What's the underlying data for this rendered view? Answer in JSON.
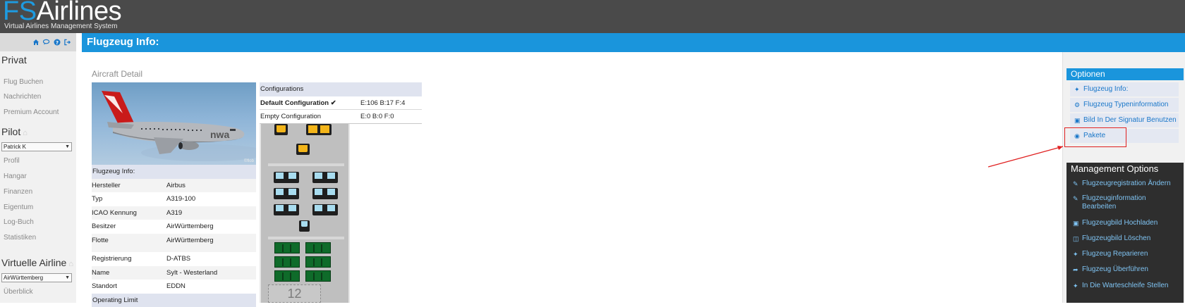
{
  "header": {
    "logo_fs": "FS",
    "logo_airlines": "Airlines",
    "logo_subtitle": "Virtual Airlines Management System"
  },
  "quickbar": {
    "icons": [
      "home-icon",
      "chat-icon",
      "help-icon",
      "logout-icon"
    ]
  },
  "sidebar": {
    "privat_heading": "Privat",
    "privat_items": [
      "Flug Buchen",
      "Nachrichten",
      "Premium Account"
    ],
    "pilot_heading": "Pilot",
    "pilot_select": "Patrick K",
    "pilot_items": [
      "Profil",
      "Hangar",
      "Finanzen",
      "Eigentum",
      "Log-Buch",
      "Statistiken"
    ],
    "va_heading": "Virtuelle Airline",
    "va_select": "AirWürttemberg",
    "va_items": [
      "Überblick"
    ]
  },
  "page": {
    "title": "Flugzeug Info:",
    "section_title": "Aircraft Detail",
    "photo_credit": "©flob",
    "livery_text": "nwa"
  },
  "info": {
    "heading": "Flugzeug Info:",
    "rows": [
      {
        "label": "Hersteller",
        "value": "Airbus"
      },
      {
        "label": "Typ",
        "value": "A319-100"
      },
      {
        "label": "ICAO Kennung",
        "value": "A319"
      },
      {
        "label": "Besitzer",
        "value": "AirWürttemberg"
      },
      {
        "label": "Flotte",
        "value": "AirWürttemberg"
      }
    ],
    "rows2": [
      {
        "label": "Registrierung",
        "value": "D-ATBS"
      },
      {
        "label": "Name",
        "value": "Sylt - Westerland"
      },
      {
        "label": "Standort",
        "value": "EDDN"
      }
    ],
    "operating_limit_heading": "Operating Limit"
  },
  "configurations": {
    "heading": "Configurations",
    "rows": [
      {
        "name": "Default Configuration",
        "check": "✔",
        "value": "E:106 B:17 F:4"
      },
      {
        "name": "Empty Configuration",
        "check": "",
        "value": "E:0 B:0 F:0"
      }
    ],
    "row_number": "12"
  },
  "options": {
    "heading": "Optionen",
    "items": [
      {
        "icon": "plane-icon",
        "label": "Flugzeug Info:"
      },
      {
        "icon": "gear-icon",
        "label": "Flugzeug Typeninformation"
      },
      {
        "icon": "image-icon",
        "label": "Bild In Der Signatur Benutzen"
      },
      {
        "icon": "package-icon",
        "label": "Pakete"
      }
    ]
  },
  "management": {
    "heading": "Management Options",
    "items": [
      {
        "icon": "pencil-icon",
        "label": "Flugzeugregistration Ändern"
      },
      {
        "icon": "pencil-icon",
        "label": "Flugzeuginformation Bearbeiten"
      },
      {
        "icon": "image-icon",
        "label": "Flugzeugbild Hochladen"
      },
      {
        "icon": "trash-icon",
        "label": "Flugzeugbild Löschen"
      },
      {
        "icon": "wrench-icon",
        "label": "Flugzeug Reparieren"
      },
      {
        "icon": "share-icon",
        "label": "Flugzeug Überführen"
      },
      {
        "icon": "wrench-icon",
        "label": "In Die Warteschleife Stellen"
      }
    ]
  },
  "colors": {
    "brand_blue": "#1a95dc",
    "header_gray": "#4a4a4a",
    "link_blue": "#1a77c9",
    "annotation_red": "#e02020"
  }
}
